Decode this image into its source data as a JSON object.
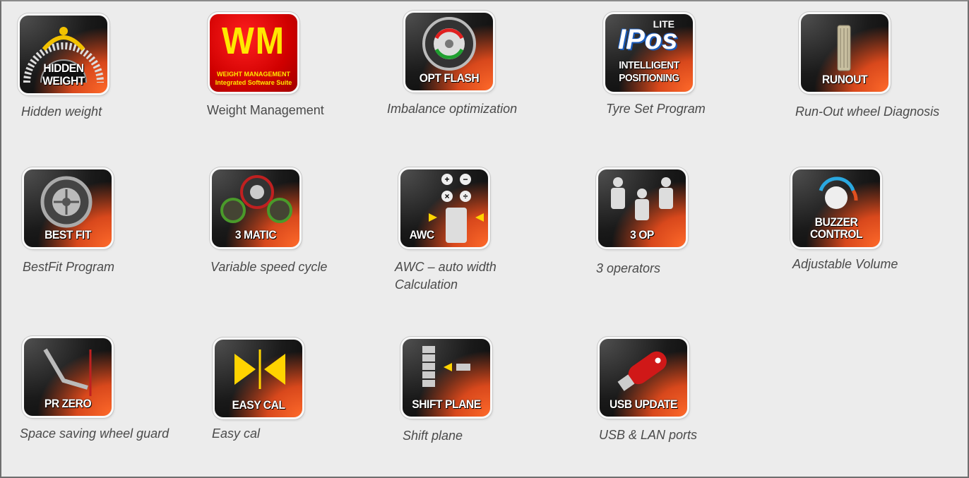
{
  "features": [
    {
      "id": "hidden-weight",
      "icon_text": "HIDDEN WEIGHT",
      "caption": "Hidden weight"
    },
    {
      "id": "weight-management",
      "icon_text": "WM",
      "icon_sub1": "WEIGHT MANAGEMENT",
      "icon_sub2": "Integrated Software Suite",
      "caption": "Weight Management"
    },
    {
      "id": "opt-flash",
      "icon_text": "OPT FLASH",
      "caption": "Imbalance optimization"
    },
    {
      "id": "ipos",
      "icon_text_top": "LITE",
      "icon_text_big": "IPos",
      "icon_text": "INTELLIGENT POSITIONING",
      "caption": "Tyre Set Program"
    },
    {
      "id": "runout",
      "icon_text": "RUNOUT",
      "caption": "Run-Out wheel Diagnosis"
    },
    {
      "id": "best-fit",
      "icon_text": "BEST FIT",
      "caption": "BestFit Program"
    },
    {
      "id": "3-matic",
      "icon_text": "3 MATIC",
      "caption": "Variable speed cycle"
    },
    {
      "id": "awc",
      "icon_text": "AWC",
      "caption_line1": "AWC – auto width",
      "caption_line2": "Calculation"
    },
    {
      "id": "3-op",
      "icon_text": "3 OP",
      "caption": "3 operators"
    },
    {
      "id": "buzzer-control",
      "icon_text_line1": "BUZZER",
      "icon_text_line2": "CONTROL",
      "caption": "Adjustable Volume"
    },
    {
      "id": "pr-zero",
      "icon_text": "PR ZERO",
      "caption": "Space saving wheel guard"
    },
    {
      "id": "easy-cal",
      "icon_text": "EASY CAL",
      "caption": "Easy cal"
    },
    {
      "id": "shift-plane",
      "icon_text": "SHIFT PLANE",
      "caption": "Shift plane"
    },
    {
      "id": "usb-update",
      "icon_text": "USB UPDATE",
      "caption": "USB & LAN ports"
    }
  ],
  "colors": {
    "background": "#ececec",
    "caption": "#4a4a4a",
    "accent_orange": "#e0521f",
    "wm_red": "#d00000",
    "wm_yellow": "#ffe800"
  }
}
